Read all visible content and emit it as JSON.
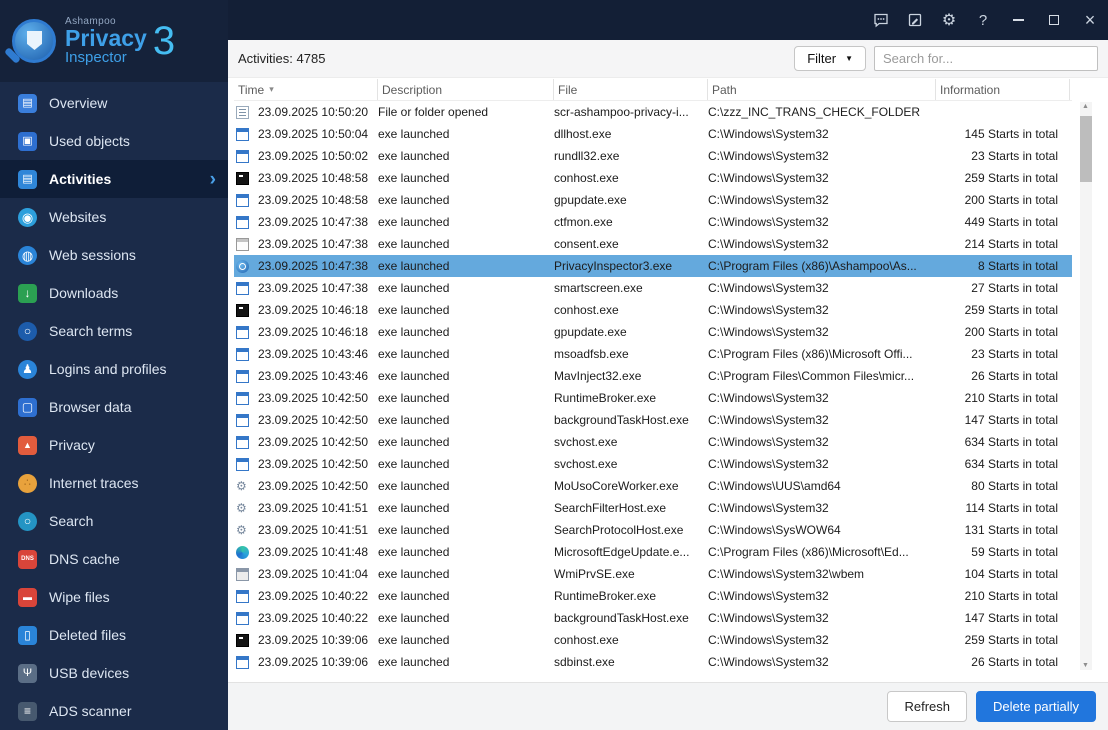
{
  "titlebar": {
    "settings_glyph": "⚙",
    "help_label": "?",
    "close_glyph": "×",
    "icons": [
      "chat-bubble",
      "report-note",
      "gear",
      "help"
    ]
  },
  "logo": {
    "brand": "Ashampoo",
    "product": "Privacy",
    "product2": "Inspector",
    "version": "3"
  },
  "sidebar": {
    "chevron": "›",
    "items": [
      {
        "id": "overview",
        "label": "Overview",
        "icon": "monitor-icon"
      },
      {
        "id": "used-objects",
        "label": "Used objects",
        "icon": "box-icon"
      },
      {
        "id": "activities",
        "label": "Activities",
        "icon": "activity-monitor-icon",
        "selected": true
      },
      {
        "id": "websites",
        "label": "Websites",
        "icon": "globe-icon"
      },
      {
        "id": "web-sessions",
        "label": "Web sessions",
        "icon": "session-globe-icon"
      },
      {
        "id": "downloads",
        "label": "Downloads",
        "icon": "download-icon"
      },
      {
        "id": "search-terms",
        "label": "Search terms",
        "icon": "magnifier-icon"
      },
      {
        "id": "logins-and-profiles",
        "label": "Logins and profiles",
        "icon": "user-icon"
      },
      {
        "id": "browser-data",
        "label": "Browser data",
        "icon": "browser-window-icon"
      },
      {
        "id": "privacy",
        "label": "Privacy",
        "icon": "shield-icon"
      },
      {
        "id": "internet-traces",
        "label": "Internet traces",
        "icon": "cookie-icon"
      },
      {
        "id": "search",
        "label": "Search",
        "icon": "search-globe-icon"
      },
      {
        "id": "dns-cache",
        "label": "DNS cache",
        "icon": "dns-icon"
      },
      {
        "id": "wipe-files",
        "label": "Wipe files",
        "icon": "wipe-icon"
      },
      {
        "id": "deleted-files",
        "label": "Deleted files",
        "icon": "trash-icon"
      },
      {
        "id": "usb-devices",
        "label": "USB devices",
        "icon": "usb-icon"
      },
      {
        "id": "ads-scanner",
        "label": "ADS scanner",
        "icon": "scanner-icon"
      }
    ]
  },
  "toolbar": {
    "count_label": "Activities: 4785",
    "filter_label": "Filter",
    "filter_caret": "▼",
    "search_placeholder": "Search for..."
  },
  "table": {
    "columns": [
      "Time",
      "Description",
      "File",
      "Path",
      "Information"
    ],
    "sort": {
      "column": "Time",
      "direction": "desc",
      "glyph": "▾"
    },
    "rows": [
      {
        "icon": "file",
        "time": "23.09.2025 10:50:20",
        "description": "File or folder opened",
        "file": "scr-ashampoo-privacy-i...",
        "path": "C:\\zzz_INC_TRANS_CHECK_FOLDER",
        "info": ""
      },
      {
        "icon": "app",
        "time": "23.09.2025 10:50:04",
        "description": "exe launched",
        "file": "dllhost.exe",
        "path": "C:\\Windows\\System32",
        "info": "145 Starts in total"
      },
      {
        "icon": "app",
        "time": "23.09.2025 10:50:02",
        "description": "exe launched",
        "file": "rundll32.exe",
        "path": "C:\\Windows\\System32",
        "info": "23 Starts in total"
      },
      {
        "icon": "console",
        "time": "23.09.2025 10:48:58",
        "description": "exe launched",
        "file": "conhost.exe",
        "path": "C:\\Windows\\System32",
        "info": "259 Starts in total"
      },
      {
        "icon": "app",
        "time": "23.09.2025 10:48:58",
        "description": "exe launched",
        "file": "gpupdate.exe",
        "path": "C:\\Windows\\System32",
        "info": "200 Starts in total"
      },
      {
        "icon": "app",
        "time": "23.09.2025 10:47:38",
        "description": "exe launched",
        "file": "ctfmon.exe",
        "path": "C:\\Windows\\System32",
        "info": "449 Starts in total"
      },
      {
        "icon": "window",
        "time": "23.09.2025 10:47:38",
        "description": "exe launched",
        "file": "consent.exe",
        "path": "C:\\Windows\\System32",
        "info": "214 Starts in total"
      },
      {
        "icon": "privacy",
        "time": "23.09.2025 10:47:38",
        "description": "exe launched",
        "file": "PrivacyInspector3.exe",
        "path": "C:\\Program Files (x86)\\Ashampoo\\As...",
        "info": "8 Starts in total",
        "selected": true
      },
      {
        "icon": "app",
        "time": "23.09.2025 10:47:38",
        "description": "exe launched",
        "file": "smartscreen.exe",
        "path": "C:\\Windows\\System32",
        "info": "27 Starts in total"
      },
      {
        "icon": "console",
        "time": "23.09.2025 10:46:18",
        "description": "exe launched",
        "file": "conhost.exe",
        "path": "C:\\Windows\\System32",
        "info": "259 Starts in total"
      },
      {
        "icon": "app",
        "time": "23.09.2025 10:46:18",
        "description": "exe launched",
        "file": "gpupdate.exe",
        "path": "C:\\Windows\\System32",
        "info": "200 Starts in total"
      },
      {
        "icon": "app",
        "time": "23.09.2025 10:43:46",
        "description": "exe launched",
        "file": "msoadfsb.exe",
        "path": "C:\\Program Files (x86)\\Microsoft Offi...",
        "info": "23 Starts in total"
      },
      {
        "icon": "app",
        "time": "23.09.2025 10:43:46",
        "description": "exe launched",
        "file": "MavInject32.exe",
        "path": "C:\\Program Files\\Common Files\\micr...",
        "info": "26 Starts in total"
      },
      {
        "icon": "app",
        "time": "23.09.2025 10:42:50",
        "description": "exe launched",
        "file": "RuntimeBroker.exe",
        "path": "C:\\Windows\\System32",
        "info": "210 Starts in total"
      },
      {
        "icon": "app",
        "time": "23.09.2025 10:42:50",
        "description": "exe launched",
        "file": "backgroundTaskHost.exe",
        "path": "C:\\Windows\\System32",
        "info": "147 Starts in total"
      },
      {
        "icon": "app",
        "time": "23.09.2025 10:42:50",
        "description": "exe launched",
        "file": "svchost.exe",
        "path": "C:\\Windows\\System32",
        "info": "634 Starts in total"
      },
      {
        "icon": "app",
        "time": "23.09.2025 10:42:50",
        "description": "exe launched",
        "file": "svchost.exe",
        "path": "C:\\Windows\\System32",
        "info": "634 Starts in total"
      },
      {
        "icon": "gear",
        "time": "23.09.2025 10:42:50",
        "description": "exe launched",
        "file": "MoUsoCoreWorker.exe",
        "path": "C:\\Windows\\UUS\\amd64",
        "info": "80 Starts in total"
      },
      {
        "icon": "gear",
        "time": "23.09.2025 10:41:51",
        "description": "exe launched",
        "file": "SearchFilterHost.exe",
        "path": "C:\\Windows\\System32",
        "info": "114 Starts in total"
      },
      {
        "icon": "gear",
        "time": "23.09.2025 10:41:51",
        "description": "exe launched",
        "file": "SearchProtocolHost.exe",
        "path": "C:\\Windows\\SysWOW64",
        "info": "131 Starts in total"
      },
      {
        "icon": "edge",
        "time": "23.09.2025 10:41:48",
        "description": "exe launched",
        "file": "MicrosoftEdgeUpdate.e...",
        "path": "C:\\Program Files (x86)\\Microsoft\\Ed...",
        "info": "59 Starts in total"
      },
      {
        "icon": "dll",
        "time": "23.09.2025 10:41:04",
        "description": "exe launched",
        "file": "WmiPrvSE.exe",
        "path": "C:\\Windows\\System32\\wbem",
        "info": "104 Starts in total"
      },
      {
        "icon": "app",
        "time": "23.09.2025 10:40:22",
        "description": "exe launched",
        "file": "RuntimeBroker.exe",
        "path": "C:\\Windows\\System32",
        "info": "210 Starts in total"
      },
      {
        "icon": "app",
        "time": "23.09.2025 10:40:22",
        "description": "exe launched",
        "file": "backgroundTaskHost.exe",
        "path": "C:\\Windows\\System32",
        "info": "147 Starts in total"
      },
      {
        "icon": "console",
        "time": "23.09.2025 10:39:06",
        "description": "exe launched",
        "file": "conhost.exe",
        "path": "C:\\Windows\\System32",
        "info": "259 Starts in total"
      },
      {
        "icon": "app",
        "time": "23.09.2025 10:39:06",
        "description": "exe launched",
        "file": "sdbinst.exe",
        "path": "C:\\Windows\\System32",
        "info": "26 Starts in total"
      }
    ]
  },
  "footer": {
    "refresh_label": "Refresh",
    "delete_label": "Delete partially"
  },
  "colors": {
    "accent": "#2176dd",
    "selected_row": "#64a9dd",
    "sidebar_bg": "#1b2b49",
    "titlebar_bg": "#131f36"
  }
}
